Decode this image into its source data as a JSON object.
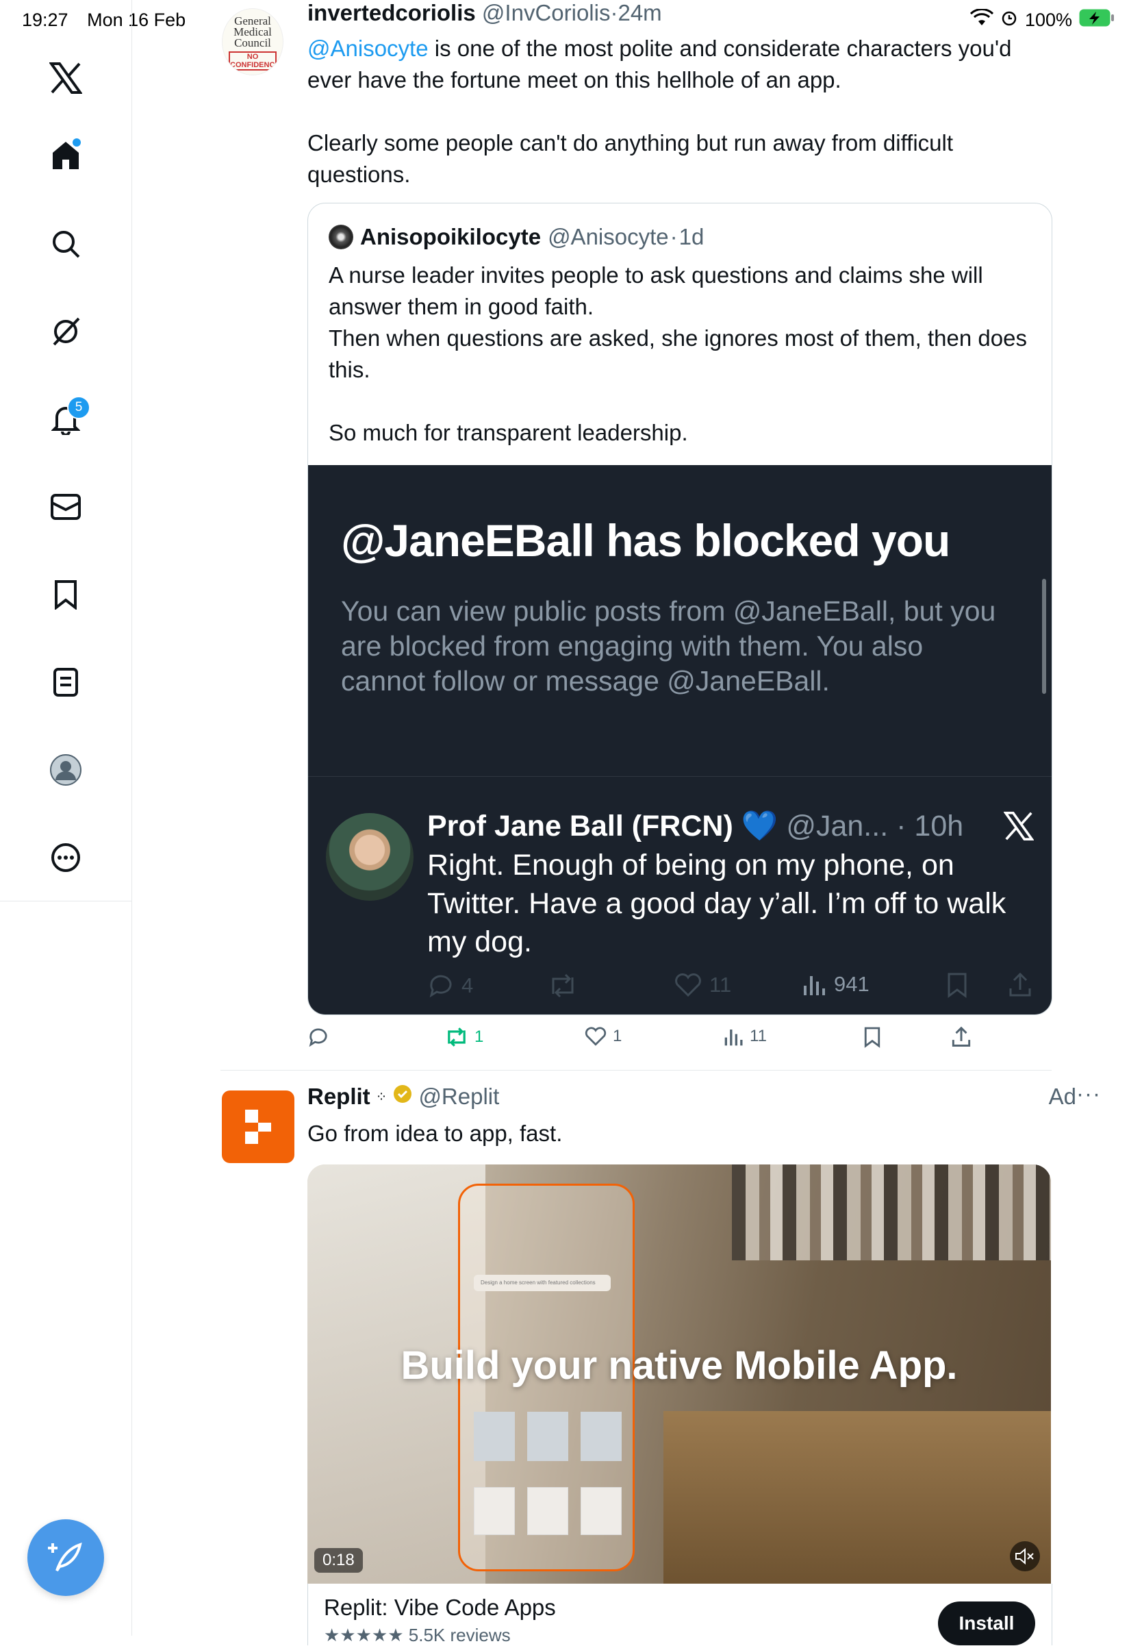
{
  "status_bar": {
    "time": "19:27",
    "date": "Mon 16 Feb",
    "battery": "100%"
  },
  "sidebar": {
    "notifications_badge": "5",
    "items": [
      "x-logo",
      "home",
      "explore",
      "grok",
      "notifications",
      "messages",
      "bookmarks",
      "lists",
      "profile",
      "more"
    ]
  },
  "tweet1": {
    "avatar_text": {
      "line1": "General",
      "line2": "Medical",
      "line3": "Council",
      "stamp": "NO CONFIDENCE"
    },
    "name": "invertedcoriolis",
    "handle": "@InvCoriolis",
    "dot": "·",
    "time": "24m",
    "mention": "@Anisocyte",
    "text_rest": " is one of the most polite and considerate characters you'd ever have the fortune meet on this hellhole of an app.",
    "text_para2": "Clearly some people can't do anything but run away from difficult questions.",
    "quote": {
      "name": "Anisopoikilocyte",
      "handle": "@Anisocyte",
      "dot": "·",
      "time": "1d",
      "line1": "A nurse leader invites people to ask questions and claims she will answer them in good faith.",
      "line2": "Then when questions are asked, she ignores most of them, then does this.",
      "line3": "So much for transparent leadership.",
      "embed": {
        "blocked_title": "@JaneEBall has blocked you",
        "blocked_desc": "You can view public posts from @JaneEBall, but you are blocked from engaging with them. You also cannot follow or message @JaneEBall.",
        "author_name": "Prof Jane Ball (FRCN)",
        "author_emoji": "💙",
        "author_handle": "@Jan...",
        "author_time": "· 10h",
        "text": "Right. Enough of being on my phone, on Twitter. Have a good day y’all. I’m off to walk my dog.",
        "replies": "4",
        "likes": "11",
        "views": "941"
      }
    },
    "actions": {
      "retweets": "1",
      "likes": "1",
      "views": "11"
    }
  },
  "ad": {
    "name": "Replit",
    "handle": "@Replit",
    "ad_label": "Ad",
    "more": "···",
    "text": "Go from idea to app, fast.",
    "media_title": "Build your native Mobile App.",
    "media_pill": "Design a home screen with featured collections",
    "video_time": "0:18",
    "app_name": "Replit: Vibe Code Apps",
    "rating_text": "★★★★★ 5.5K reviews",
    "install_label": "Install",
    "brand_color": "#f26207"
  },
  "colors": {
    "accent": "#1d9bf0",
    "embed_bg": "#1b222c",
    "retweet_green": "#00ba7c",
    "fab": "#4a99e9"
  }
}
